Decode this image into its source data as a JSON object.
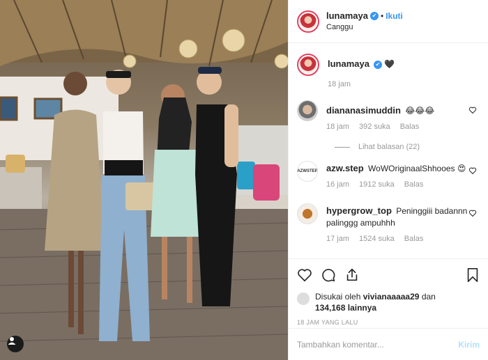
{
  "post": {
    "username": "lunamaya",
    "follow_label": "Ikuti",
    "location": "Canggu",
    "caption_emoji": "🖤",
    "caption_time": "18 jam"
  },
  "comments": [
    {
      "username": "diananasimuddin",
      "text": "😂😂😂",
      "time": "18 jam",
      "likes": "392 suka",
      "reply_label": "Balas",
      "view_replies": "Lihat balasan (22)"
    },
    {
      "username": "azw.step",
      "text": "WoWOriginaalShhooes 😍",
      "time": "16 jam",
      "likes": "1912 suka",
      "reply_label": "Balas"
    },
    {
      "username": "hypergrow_top",
      "text": "Peninggiii badannn palinggg ampuhhh",
      "time": "17 jam",
      "likes": "1524 suka",
      "reply_label": "Balas"
    }
  ],
  "likes": {
    "prefix": "Disukai oleh",
    "liker": "vivianaaaaa29",
    "joiner": "dan",
    "count": "134,168",
    "suffix": "lainnya"
  },
  "timestamp": "18 JAM YANG LALU",
  "comment_box": {
    "placeholder": "Tambahkan komentar...",
    "post_label": "Kirim"
  },
  "colors": {
    "accent": "#3897f0",
    "muted": "#999999",
    "border": "#efefef"
  },
  "icons": [
    "heart-icon",
    "comment-icon",
    "share-icon",
    "bookmark-icon",
    "verified-icon",
    "user-tag-icon"
  ]
}
